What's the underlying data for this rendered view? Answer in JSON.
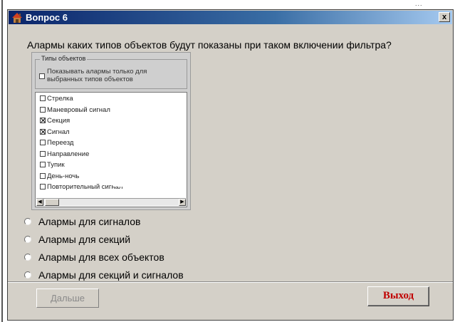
{
  "background": {
    "top_right_text": "..."
  },
  "window": {
    "title": "Вопрос  6",
    "close_label": "x"
  },
  "question": "Алармы каких типов объектов будут показаны при таком включении фильтра?",
  "filter": {
    "group_title": "Типы объектов",
    "only_selected_label": "Показывать алармы только для выбранных типов объектов",
    "only_selected_checked": false,
    "items": [
      {
        "label": "Стрелка",
        "checked": false
      },
      {
        "label": "Маневровый сигнал",
        "checked": false
      },
      {
        "label": "Секция",
        "checked": true
      },
      {
        "label": "Сигнал",
        "checked": true
      },
      {
        "label": "Переезд",
        "checked": false
      },
      {
        "label": "Направление",
        "checked": false
      },
      {
        "label": "Тупик",
        "checked": false
      },
      {
        "label": "День-ночь",
        "checked": false
      },
      {
        "label": "Повторительный сигнал",
        "checked": false
      }
    ]
  },
  "answers": [
    {
      "label": "Алармы для сигналов"
    },
    {
      "label": "Алармы для секций"
    },
    {
      "label": "Алармы для всех объектов"
    },
    {
      "label": "Алармы для секций и сигналов"
    }
  ],
  "buttons": {
    "next_label": "Дальше",
    "exit_label": "Выход"
  }
}
